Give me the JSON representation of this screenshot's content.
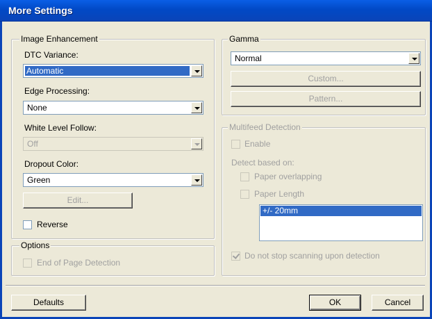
{
  "window": {
    "title": "More Settings"
  },
  "image_enhancement": {
    "legend": "Image Enhancement",
    "dtc_variance": {
      "label": "DTC Variance:",
      "value": "Automatic"
    },
    "edge_processing": {
      "label": "Edge Processing:",
      "value": "None"
    },
    "white_level_follow": {
      "label": "White Level Follow:",
      "value": "Off"
    },
    "dropout_color": {
      "label": "Dropout Color:",
      "value": "Green"
    },
    "edit_label": "Edit...",
    "reverse_label": "Reverse"
  },
  "options": {
    "legend": "Options",
    "end_of_page_label": "End of Page Detection"
  },
  "gamma": {
    "legend": "Gamma",
    "value": "Normal",
    "custom_label": "Custom...",
    "pattern_label": "Pattern..."
  },
  "multifeed": {
    "legend": "Multifeed Detection",
    "enable_label": "Enable",
    "detect_label": "Detect based on:",
    "paper_overlapping_label": "Paper overlapping",
    "paper_length_label": "Paper Length",
    "length_items": [
      "+/- 20mm"
    ],
    "do_not_stop_label": "Do not stop scanning upon detection"
  },
  "footer": {
    "defaults_label": "Defaults",
    "ok_label": "OK",
    "cancel_label": "Cancel"
  },
  "colors": {
    "titlebar": "#0149c6",
    "selection": "#316ac5",
    "face": "#ece9d8"
  }
}
